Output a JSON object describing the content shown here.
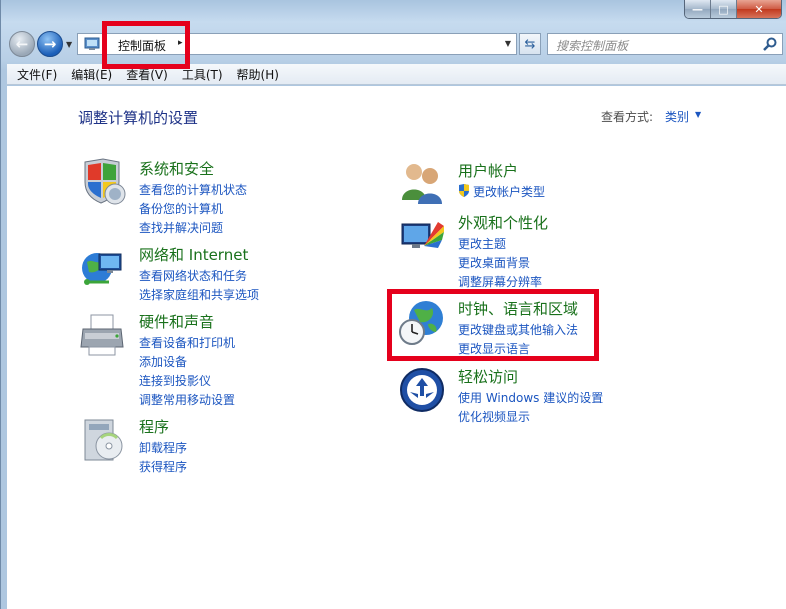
{
  "window": {
    "buttons": {
      "minimize": "—",
      "maximize": "□",
      "close": "✕"
    }
  },
  "address": {
    "breadcrumb": "控制面板",
    "arrow": "▸",
    "search_placeholder": "搜索控制面板"
  },
  "menu": [
    "文件(F)",
    "编辑(E)",
    "查看(V)",
    "工具(T)",
    "帮助(H)"
  ],
  "page": {
    "title": "调整计算机的设置",
    "view_by_label": "查看方式:",
    "view_by_value": "类别"
  },
  "categories": [
    {
      "title": "系统和安全",
      "icon": "shield-icon",
      "links": [
        "查看您的计算机状态",
        "备份您的计算机",
        "查找并解决问题"
      ]
    },
    {
      "title": "网络和 Internet",
      "icon": "network-icon",
      "links": [
        "查看网络状态和任务",
        "选择家庭组和共享选项"
      ]
    },
    {
      "title": "硬件和声音",
      "icon": "printer-icon",
      "links": [
        "查看设备和打印机",
        "添加设备",
        "连接到投影仪",
        "调整常用移动设置"
      ]
    },
    {
      "title": "程序",
      "icon": "programs-icon",
      "links": [
        "卸载程序",
        "获得程序"
      ]
    },
    {
      "title": "用户帐户",
      "icon": "users-icon",
      "links": [
        "更改帐户类型"
      ]
    },
    {
      "title": "外观和个性化",
      "icon": "appearance-icon",
      "links": [
        "更改主题",
        "更改桌面背景",
        "调整屏幕分辨率"
      ]
    },
    {
      "title": "时钟、语言和区域",
      "icon": "clock-globe-icon",
      "links": [
        "更改键盘或其他输入法",
        "更改显示语言"
      ]
    },
    {
      "title": "轻松访问",
      "icon": "ease-of-access-icon",
      "links": [
        "使用 Windows 建议的设置",
        "优化视频显示"
      ]
    }
  ],
  "colors": {
    "category_title": "#19711b",
    "link": "#1c56c0",
    "page_title": "#1e3287",
    "highlight": "#e5001c"
  }
}
